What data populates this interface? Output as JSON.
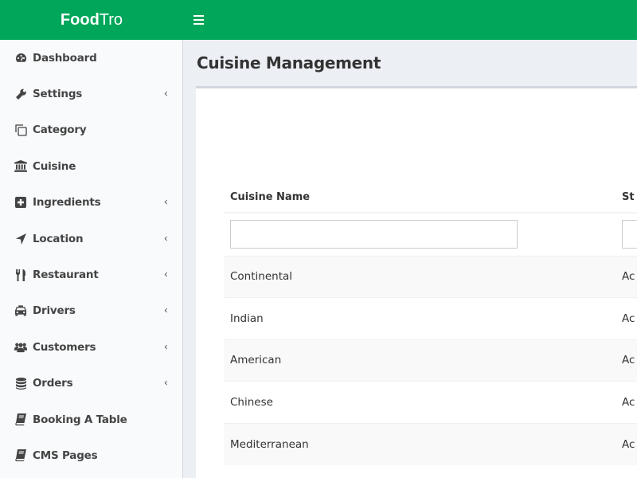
{
  "app": {
    "brand_bold": "Food",
    "brand_light": "Tro",
    "accent_color": "#00a65a"
  },
  "sidebar": {
    "items": [
      {
        "label": "Dashboard",
        "icon": "dashboard-icon",
        "has_submenu": false
      },
      {
        "label": "Settings",
        "icon": "wrench-icon",
        "has_submenu": true
      },
      {
        "label": "Category",
        "icon": "copy-icon",
        "has_submenu": false
      },
      {
        "label": "Cuisine",
        "icon": "bank-icon",
        "has_submenu": false
      },
      {
        "label": "Ingredients",
        "icon": "plus-square-icon",
        "has_submenu": true
      },
      {
        "label": "Location",
        "icon": "location-arrow-icon",
        "has_submenu": true
      },
      {
        "label": "Restaurant",
        "icon": "cutlery-icon",
        "has_submenu": true
      },
      {
        "label": "Drivers",
        "icon": "taxi-icon",
        "has_submenu": true
      },
      {
        "label": "Customers",
        "icon": "users-icon",
        "has_submenu": true
      },
      {
        "label": "Orders",
        "icon": "database-icon",
        "has_submenu": true
      },
      {
        "label": "Booking A Table",
        "icon": "book-icon",
        "has_submenu": false
      },
      {
        "label": "CMS Pages",
        "icon": "book-icon",
        "has_submenu": false
      }
    ],
    "chevron": "‹"
  },
  "main": {
    "title": "Cuisine Management",
    "table": {
      "columns": [
        "Cuisine Name",
        "St"
      ],
      "filter": {
        "name_value": "",
        "status_value": ""
      },
      "rows": [
        {
          "name": "Continental",
          "status": "Ac"
        },
        {
          "name": "Indian",
          "status": "Ac"
        },
        {
          "name": "American",
          "status": "Ac"
        },
        {
          "name": "Chinese",
          "status": "Ac"
        },
        {
          "name": "Mediterranean",
          "status": "Ac"
        }
      ]
    }
  }
}
